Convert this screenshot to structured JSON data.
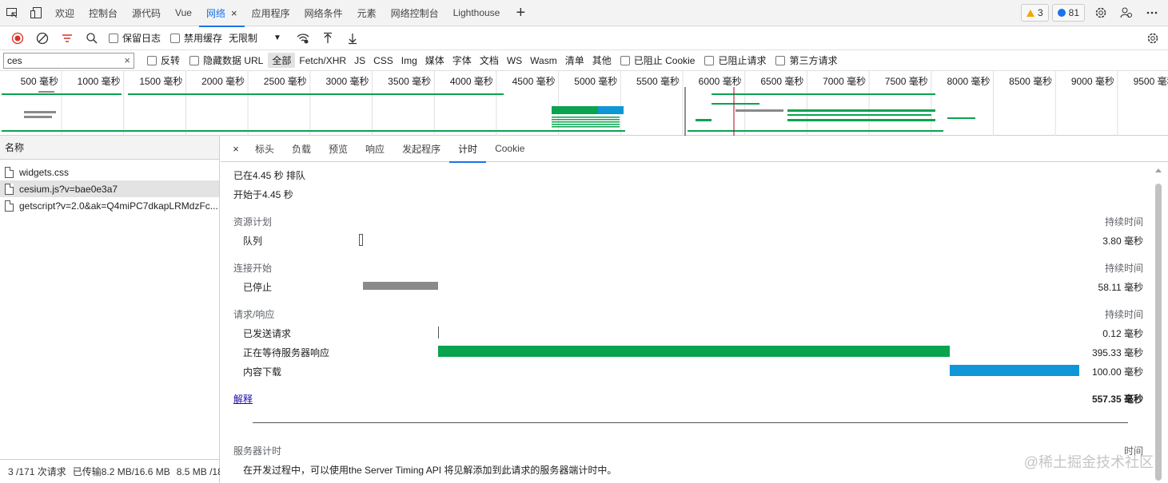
{
  "tabs": [
    {
      "label": "欢迎"
    },
    {
      "label": "控制台"
    },
    {
      "label": "源代码"
    },
    {
      "label": "Vue"
    },
    {
      "label": "网络",
      "active": true,
      "close": "×"
    },
    {
      "label": "应用程序"
    },
    {
      "label": "网络条件"
    },
    {
      "label": "元素"
    },
    {
      "label": "网络控制台"
    },
    {
      "label": "Lighthouse"
    }
  ],
  "tabbar": {
    "add": "+",
    "warnings": "3",
    "messages": "81"
  },
  "toolbar": {
    "preserve_log": "保留日志",
    "disable_cache": "禁用缓存",
    "throttle": "无限制",
    "throttle_arrow": "▼"
  },
  "filter": {
    "value": "ces",
    "clear": "×",
    "invert": "反转",
    "hide_data_urls": "隐藏数据 URL",
    "types": [
      "全部",
      "Fetch/XHR",
      "JS",
      "CSS",
      "Img",
      "媒体",
      "字体",
      "文档",
      "WS",
      "Wasm",
      "清单",
      "其他"
    ],
    "blocked_cookies": "已阻止 Cookie",
    "blocked_requests": "已阻止请求",
    "third_party": "第三方请求"
  },
  "overview": {
    "ticks": [
      "500 毫秒",
      "1000 毫秒",
      "1500 毫秒",
      "2000 毫秒",
      "2500 毫秒",
      "3000 毫秒",
      "3500 毫秒",
      "4000 毫秒",
      "4500 毫秒",
      "5000 毫秒",
      "5500 毫秒",
      "6000 毫秒",
      "6500 毫秒",
      "7000 毫秒",
      "7500 毫秒",
      "8000 毫秒",
      "8500 毫秒",
      "9000 毫秒",
      "9500 毫秒"
    ]
  },
  "requests": {
    "header": "名称",
    "items": [
      {
        "name": "widgets.css"
      },
      {
        "name": "cesium.js?v=bae0e3a7",
        "selected": true
      },
      {
        "name": "getscript?v=2.0&ak=Q4miPC7dkapLRMdzFc..."
      }
    ],
    "status": {
      "count": "3 /171 次请求",
      "transferred": "已传输8.2 MB/16.6 MB",
      "resources": "8.5 MB /18"
    }
  },
  "detail": {
    "close": "×",
    "tabs": [
      "标头",
      "负载",
      "预览",
      "响应",
      "发起程序",
      "计时",
      "Cookie"
    ],
    "active_tab": "计时",
    "queued_at": "已在4.45 秒 排队",
    "started_at": "开始于4.45 秒",
    "duration_label": "持续时间",
    "sections": [
      {
        "title": "资源计划",
        "rows": [
          {
            "label": "队列",
            "value": "3.80 毫秒"
          }
        ]
      },
      {
        "title": "连接开始",
        "rows": [
          {
            "label": "已停止",
            "value": "58.11 毫秒"
          }
        ]
      },
      {
        "title": "请求/响应",
        "rows": [
          {
            "label": "已发送请求",
            "value": "0.12 毫秒"
          },
          {
            "label": "正在等待服务器响应",
            "value": "395.33 毫秒"
          },
          {
            "label": "内容下载",
            "value": "100.00 毫秒"
          }
        ]
      }
    ],
    "explain": "解释",
    "total": "557.35 毫秒",
    "server_timing_title": "服务器计时",
    "server_timing_time": "时间",
    "server_timing_note": "在开发过程中，可以使用the Server Timing API 将见解添加到此请求的服务器端计时中。"
  },
  "colors": {
    "accent": "#1a73e8",
    "waiting": "#0aa34f",
    "download": "#0e96d6",
    "stalled": "#8a8a8a",
    "record": "#d93025"
  },
  "watermark": "@稀土掘金技术社区"
}
